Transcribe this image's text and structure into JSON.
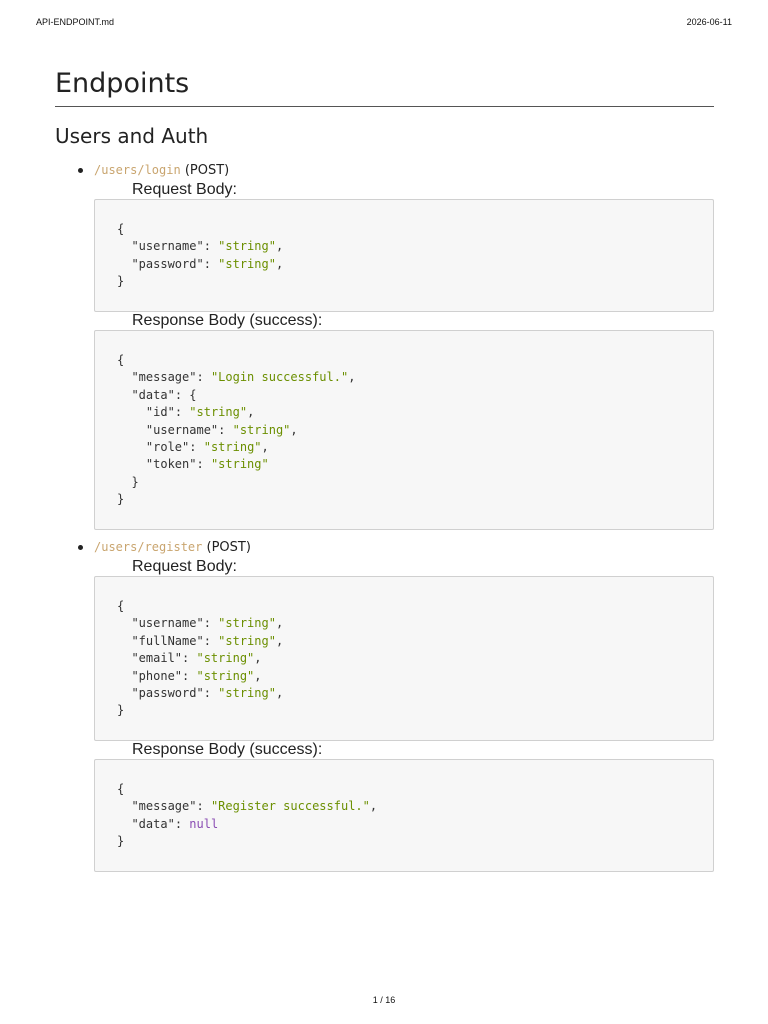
{
  "header": {
    "filename": "API-ENDPOINT.md",
    "date": "2026-06-11"
  },
  "footer": {
    "page": "1 / 16"
  },
  "doc": {
    "title": "Endpoints",
    "section": "Users and Auth",
    "endpoints": [
      {
        "path": "/users/login",
        "method": "(POST)",
        "request_label": "Request Body:",
        "response_label": "Response Body (success):"
      },
      {
        "path": "/users/register",
        "method": "(POST)",
        "request_label": "Request Body:",
        "response_label": "Response Body (success):"
      }
    ],
    "code": {
      "open": "{",
      "close": "}",
      "inner_close": "}",
      "colon": ": ",
      "comma": ",",
      "obj_open": "{",
      "login_request": {
        "k1": "\"username\"",
        "v1": "\"string\"",
        "k2": "\"password\"",
        "v2": "\"string\""
      },
      "login_response": {
        "k_message": "\"message\"",
        "v_message": "\"Login successful.\"",
        "k_data": "\"data\"",
        "k_id": "\"id\"",
        "v_id": "\"string\"",
        "k_username": "\"username\"",
        "v_username": "\"string\"",
        "k_role": "\"role\"",
        "v_role": "\"string\"",
        "k_token": "\"token\"",
        "v_token": "\"string\""
      },
      "register_request": {
        "k_username": "\"username\"",
        "v_username": "\"string\"",
        "k_fullName": "\"fullName\"",
        "v_fullName": "\"string\"",
        "k_email": "\"email\"",
        "v_email": "\"string\"",
        "k_phone": "\"phone\"",
        "v_phone": "\"string\"",
        "k_password": "\"password\"",
        "v_password": "\"string\""
      },
      "register_response": {
        "k_message": "\"message\"",
        "v_message": "\"Register successful.\"",
        "k_data": "\"data\"",
        "v_data": "null"
      }
    }
  }
}
